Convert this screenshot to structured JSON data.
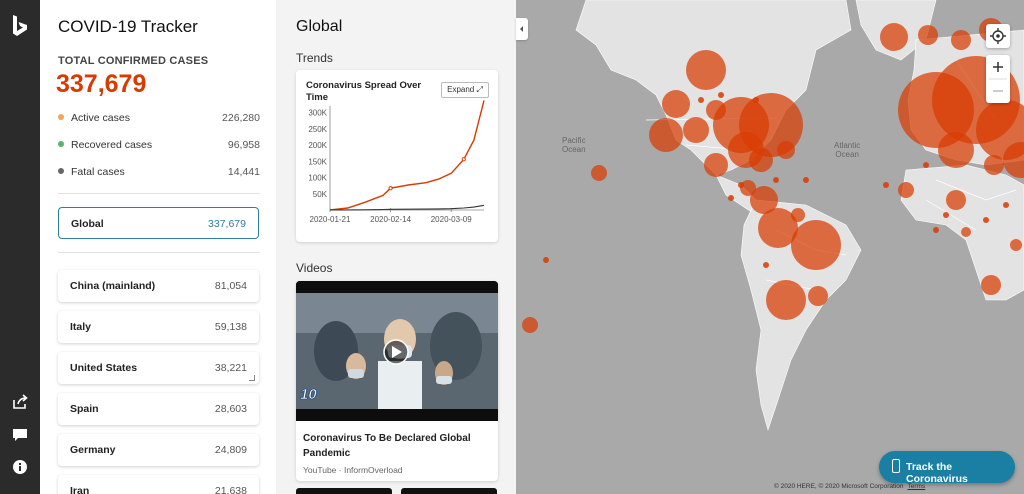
{
  "app": {
    "title": "COVID-19 Tracker",
    "total_label": "TOTAL CONFIRMED CASES",
    "total_value": "337,679",
    "stats": [
      {
        "label": "Active cases",
        "value": "226,280",
        "color": "#f0a657"
      },
      {
        "label": "Recovered cases",
        "value": "96,958",
        "color": "#5bb26d"
      },
      {
        "label": "Fatal cases",
        "value": "14,441",
        "color": "#666666"
      }
    ],
    "global_item": {
      "name": "Global",
      "value": "337,679"
    },
    "regions": [
      {
        "name": "China (mainland)",
        "value": "81,054"
      },
      {
        "name": "Italy",
        "value": "59,138"
      },
      {
        "name": "United States",
        "value": "38,221"
      },
      {
        "name": "Spain",
        "value": "28,603"
      },
      {
        "name": "Germany",
        "value": "24,809"
      },
      {
        "name": "Iran",
        "value": "21,638"
      }
    ]
  },
  "detail": {
    "title": "Global",
    "trends_label": "Trends",
    "chart_title": "Coronavirus Spread Over Time",
    "expand_label": "Expand",
    "videos_label": "Videos",
    "video": {
      "title": "Coronavirus To Be Declared Global Pandemic",
      "source": "YouTube · InformOverload",
      "badge": "10"
    }
  },
  "map": {
    "pacific_label": "Pacific\nOcean",
    "atlantic_label": "Atlantic\nOcean",
    "track_button": "Track the Coronavirus",
    "copyright": "© 2020 HERE, © 2020 Microsoft Corporation",
    "terms": "Terms",
    "bubble_color": "#d83b01"
  },
  "chart_data": {
    "type": "line",
    "title": "Coronavirus Spread Over Time",
    "x": [
      "2020-01-21",
      "2020-01-28",
      "2020-02-04",
      "2020-02-11",
      "2020-02-14",
      "2020-02-21",
      "2020-02-28",
      "2020-03-04",
      "2020-03-09",
      "2020-03-14",
      "2020-03-18",
      "2020-03-22"
    ],
    "x_tick_labels": [
      "2020-01-21",
      "2020-02-14",
      "2020-03-09"
    ],
    "y_tick_labels": [
      "50K",
      "100K",
      "150K",
      "200K",
      "250K",
      "300K"
    ],
    "ylim": [
      0,
      320000
    ],
    "series": [
      {
        "color": "#d83b01",
        "values": [
          300,
          6000,
          24000,
          45000,
          67000,
          77000,
          84000,
          95000,
          113000,
          156000,
          215000,
          337000
        ]
      },
      {
        "color": "#333333",
        "values": [
          0,
          200,
          700,
          1500,
          2000,
          2400,
          2900,
          3300,
          3900,
          6000,
          9000,
          14400
        ]
      }
    ]
  }
}
